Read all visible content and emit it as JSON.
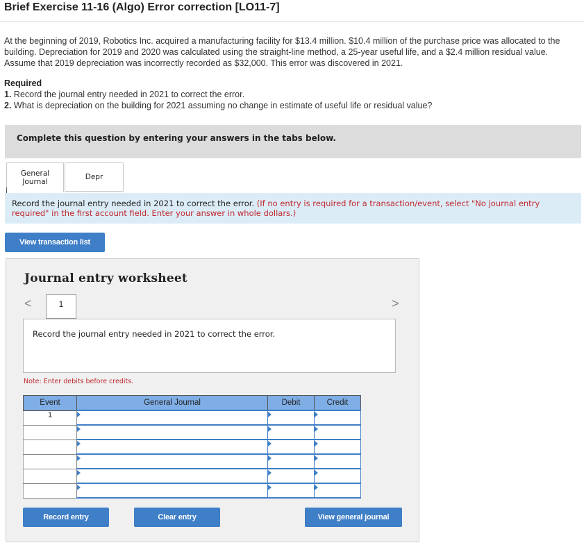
{
  "header": {
    "title": "Brief Exercise 11-16 (Algo) Error correction [LO11-7]"
  },
  "problem": {
    "text": "At the beginning of 2019, Robotics Inc. acquired a manufacturing facility for $13.4 million. $10.4 million of the purchase price was allocated to the building. Depreciation for 2019 and 2020 was calculated using the straight-line method, a 25-year useful life, and a $2.4 million residual value. Assume that 2019 depreciation was incorrectly recorded as $32,000. This error was discovered in 2021.",
    "required_label": "Required",
    "req1_num": "1.",
    "req1_text": " Record the journal entry needed in 2021 to correct the error.",
    "req2_num": "2.",
    "req2_text": " What is depreciation on the building for 2021 assuming no change in estimate of useful life or residual value?"
  },
  "complete_banner": "Complete this question by entering your answers in the tabs below.",
  "tabs": [
    {
      "label_line1": "General",
      "label_line2": "Journal",
      "active": true
    },
    {
      "label": "Depr",
      "active": false
    }
  ],
  "instruction": {
    "main": "Record the journal entry needed in 2021 to correct the error.",
    "note": " (If no entry is required for a transaction/event, select \"No journal entry required\" in the first account field. Enter your answer in whole dollars.)"
  },
  "buttons": {
    "view_transaction_list": "View transaction list",
    "record_entry": "Record entry",
    "clear_entry": "Clear entry",
    "view_general_journal": "View general journal"
  },
  "worksheet": {
    "title": "Journal entry worksheet",
    "page": "1",
    "nav_prev": "<",
    "nav_next": ">",
    "description": "Record the journal entry needed in 2021 to correct the error.",
    "note": "Note: Enter debits before credits.",
    "columns": [
      "Event",
      "General Journal",
      "Debit",
      "Credit"
    ],
    "rows": [
      {
        "event": "1",
        "account": "",
        "debit": "",
        "credit": ""
      },
      {
        "event": "",
        "account": "",
        "debit": "",
        "credit": ""
      },
      {
        "event": "",
        "account": "",
        "debit": "",
        "credit": ""
      },
      {
        "event": "",
        "account": "",
        "debit": "",
        "credit": ""
      },
      {
        "event": "",
        "account": "",
        "debit": "",
        "credit": ""
      },
      {
        "event": "",
        "account": "",
        "debit": "",
        "credit": ""
      }
    ]
  },
  "colors": {
    "button_blue": "#3f7fc7",
    "header_blue": "#7faee6",
    "instruction_bg": "#dcecf7",
    "note_red": "#c0282d"
  }
}
